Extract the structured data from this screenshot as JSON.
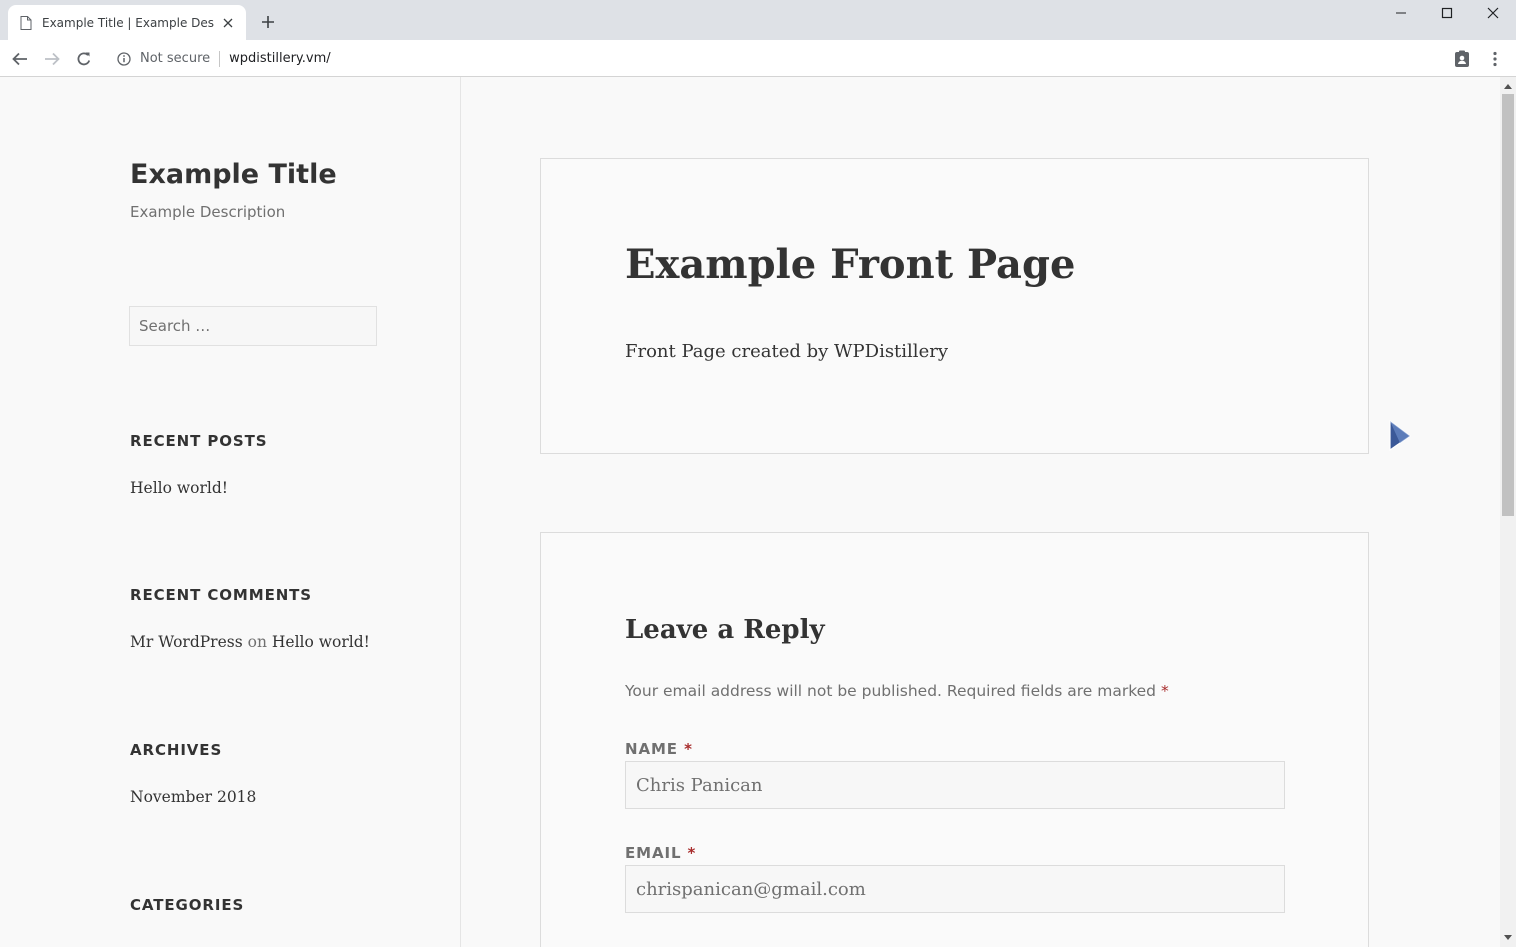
{
  "browser": {
    "tab_title": "Example Title | Example Description",
    "security_label": "Not secure",
    "url": "wpdistillery.vm/"
  },
  "sidebar": {
    "site_title": "Example Title",
    "site_description": "Example Description",
    "search_placeholder": "Search …",
    "recent_posts": {
      "title": "RECENT POSTS",
      "items": [
        "Hello world!"
      ]
    },
    "recent_comments": {
      "title": "RECENT COMMENTS",
      "author": "Mr WordPress",
      "connector": "on",
      "post": "Hello world!"
    },
    "archives": {
      "title": "ARCHIVES",
      "items": [
        "November 2018"
      ]
    },
    "categories": {
      "title": "CATEGORIES"
    }
  },
  "main": {
    "entry_title": "Example Front Page",
    "entry_content": "Front Page created by WPDistillery",
    "reply": {
      "title": "Leave a Reply",
      "notes": "Your email address will not be published. Required fields are marked",
      "required_marker": "*",
      "name_label": "NAME",
      "name_value": "Chris Panican",
      "email_label": "EMAIL",
      "email_value": "chrispanican@gmail.com"
    }
  },
  "colors": {
    "required": "#a82d2d",
    "text": "#333333",
    "muted": "#707070"
  }
}
